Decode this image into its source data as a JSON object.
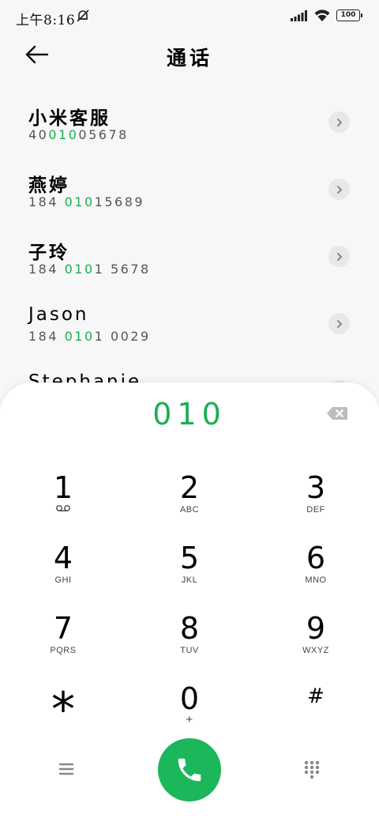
{
  "status_bar": {
    "time": "上午8:16",
    "battery": "100"
  },
  "header": {
    "title": "通话"
  },
  "contacts": [
    {
      "name": "小米客服",
      "number_parts": [
        "40",
        "010",
        "05678"
      ]
    },
    {
      "name": "燕婷",
      "number_parts": [
        "184 ",
        "010",
        "15689"
      ]
    },
    {
      "name": "子玲",
      "number_parts": [
        "184 ",
        "010",
        "1 5678"
      ]
    },
    {
      "name": "Jason",
      "number_parts": [
        "184 ",
        "010",
        "1 0029"
      ]
    },
    {
      "name": "Stephanie",
      "number_parts": [
        "",
        "",
        ""
      ]
    }
  ],
  "dialpad": {
    "input": "010",
    "keys": [
      {
        "digit": "1",
        "letters": ""
      },
      {
        "digit": "2",
        "letters": "ABC"
      },
      {
        "digit": "3",
        "letters": "DEF"
      },
      {
        "digit": "4",
        "letters": "GHI"
      },
      {
        "digit": "5",
        "letters": "JKL"
      },
      {
        "digit": "6",
        "letters": "MNO"
      },
      {
        "digit": "7",
        "letters": "PQRS"
      },
      {
        "digit": "8",
        "letters": "TUV"
      },
      {
        "digit": "9",
        "letters": "WXYZ"
      },
      {
        "digit": "*",
        "letters": ""
      },
      {
        "digit": "0",
        "letters": "+"
      },
      {
        "digit": "#",
        "letters": ""
      }
    ]
  },
  "colors": {
    "accent": "#1aaf54",
    "call_button": "#1cb65b"
  },
  "icons": {
    "back": "arrow-left-icon",
    "detail": "chevron-right-icon",
    "delete": "backspace-icon",
    "voicemail": "voicemail-icon",
    "menu": "hamburger-menu-icon",
    "call": "phone-icon",
    "keypad": "dialpad-grid-icon"
  }
}
